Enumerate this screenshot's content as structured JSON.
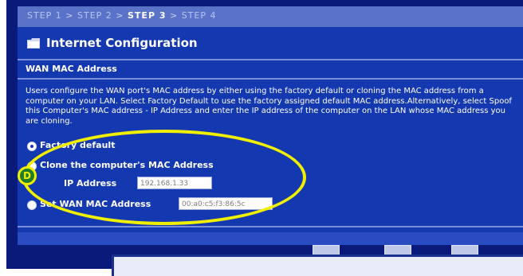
{
  "steps": {
    "items": [
      {
        "label": "STEP 1",
        "current": false
      },
      {
        "label": "STEP 2",
        "current": false
      },
      {
        "label": "STEP 3",
        "current": true
      },
      {
        "label": "STEP 4",
        "current": false
      }
    ],
    "separator": ">"
  },
  "page": {
    "title": "Internet Configuration",
    "section_title": "WAN MAC Address",
    "description": "Users configure the WAN port's MAC address by either using the factory default or cloning the MAC address from a computer on your LAN. Select Factory Default to use the factory assigned default MAC address.Alternatively, select Spoof this Computer's MAC address - IP Address and enter the IP address of the computer on the LAN whose MAC address you are cloning."
  },
  "options": {
    "factory_default": {
      "label": "Factory default",
      "selected": true
    },
    "clone": {
      "label": "Clone the computer's MAC Address",
      "selected": false
    },
    "ip_address": {
      "label": "IP Address",
      "value": "192.168.1.33"
    },
    "set_wan_mac": {
      "label": "Set WAN MAC Address",
      "value": "00:a0:c5:f3:86:5c",
      "selected": false
    }
  },
  "annotation": {
    "marker": "D"
  },
  "colors": {
    "panel_bg": "#1438b0",
    "highlight": "#f1ef00",
    "marker_text": "#1f7d2c"
  },
  "icons": {
    "title_icon": "folder-icon"
  }
}
